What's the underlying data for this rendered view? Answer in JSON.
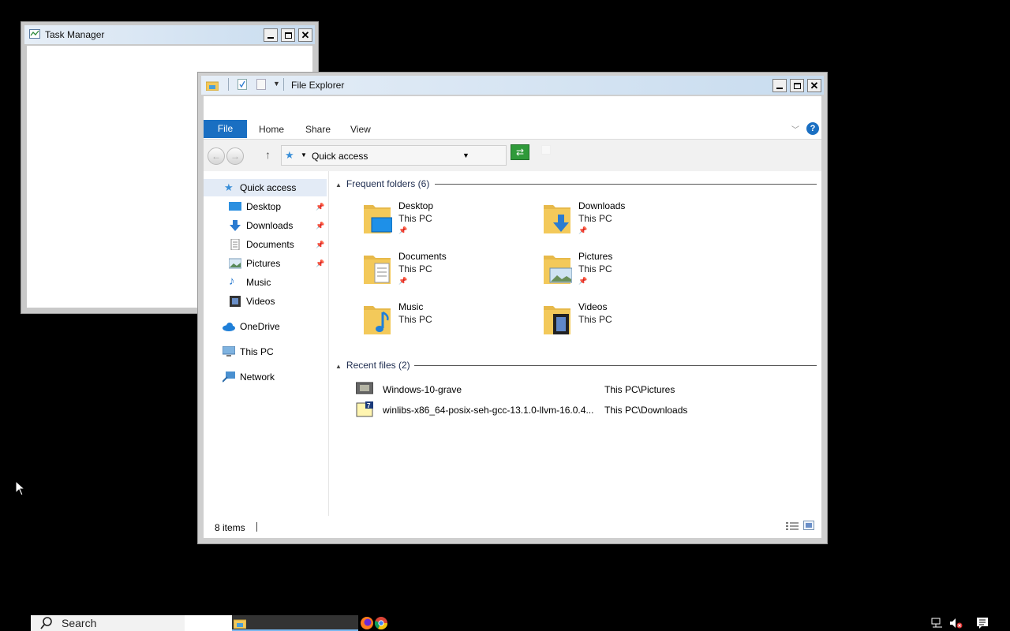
{
  "task_manager": {
    "title": "Task Manager"
  },
  "explorer": {
    "title": "File Explorer",
    "tabs": [
      "File",
      "Home",
      "Share",
      "View"
    ],
    "address": "Quick access",
    "nav": {
      "quick_access": "Quick access",
      "pinned": [
        {
          "label": "Desktop",
          "icon": "desktop-icon"
        },
        {
          "label": "Downloads",
          "icon": "downloads-icon"
        },
        {
          "label": "Documents",
          "icon": "documents-icon"
        },
        {
          "label": "Pictures",
          "icon": "pictures-icon"
        },
        {
          "label": "Music",
          "icon": "music-icon"
        },
        {
          "label": "Videos",
          "icon": "videos-icon"
        }
      ],
      "onedrive": "OneDrive",
      "this_pc": "This PC",
      "network": "Network"
    },
    "frequent": {
      "header": "Frequent folders",
      "count": "(6)",
      "items": [
        {
          "name": "Desktop",
          "location": "This PC",
          "pinned": true
        },
        {
          "name": "Downloads",
          "location": "This PC",
          "pinned": true
        },
        {
          "name": "Documents",
          "location": "This PC",
          "pinned": true
        },
        {
          "name": "Pictures",
          "location": "This PC",
          "pinned": true
        },
        {
          "name": "Music",
          "location": "This PC",
          "pinned": false
        },
        {
          "name": "Videos",
          "location": "This PC",
          "pinned": false
        }
      ]
    },
    "recent": {
      "header": "Recent files",
      "count": "(2)",
      "items": [
        {
          "name": "Windows-10-grave",
          "path": "This PC\\Pictures"
        },
        {
          "name": "winlibs-x86_64-posix-seh-gcc-13.1.0-llvm-16.0.4...",
          "path": "This PC\\Downloads"
        }
      ]
    },
    "status": {
      "items": "8 items"
    }
  },
  "taskbar": {
    "search": "Search"
  },
  "colors": {
    "accent": "#1a6fc2",
    "folder": "#f3c95a",
    "desktop_bg": "#000000"
  }
}
